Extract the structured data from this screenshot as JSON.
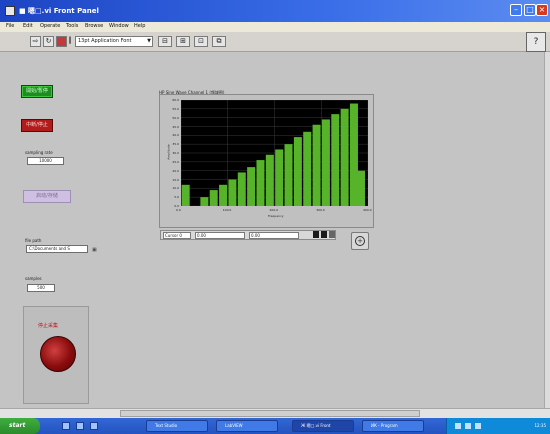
{
  "window": {
    "title": "■ 嗯□.vi Front Panel"
  },
  "menu": [
    "File",
    "Edit",
    "Operate",
    "Tools",
    "Browse",
    "Window",
    "Help"
  ],
  "toolbar": {
    "font_select": "13pt Application Font"
  },
  "panel": {
    "green_button": "開始/暫停",
    "red_button": "中断/停止",
    "sample_rate_label": "sampling rate",
    "sample_rate_value": "10000",
    "pink_button": "启动/存储",
    "file_path_label": "file path",
    "file_path_value": "C:\\Documents and S",
    "samples_label": "samples",
    "samples_value": "500",
    "stop_label": "停止采集"
  },
  "graph": {
    "title": "HP Sine Wave Channel 1 (频域图)",
    "y_label": "Amplitude",
    "x_label": "Frequency",
    "cursor": {
      "name": "Cursor 0",
      "x_value": "0.00",
      "y_value": "0.00"
    }
  },
  "chart_data": {
    "type": "bar",
    "title": "HP Sine Wave Channel 1 (频域图)",
    "xlabel": "Frequency",
    "ylabel": "Amplitude",
    "y_ticks": [
      "60.0",
      "55.0",
      "50.0",
      "45.0",
      "40.0",
      "35.0",
      "30.0",
      "25.0",
      "20.0",
      "15.0",
      "10.0",
      "5.0",
      "0.0"
    ],
    "x_ticks": [
      "0.0",
      "100.0",
      "200.0",
      "300.0",
      "400.0"
    ],
    "ylim": [
      0,
      60
    ],
    "xlim": [
      0,
      400
    ],
    "x": [
      10,
      30,
      50,
      70,
      90,
      110,
      130,
      150,
      170,
      190,
      210,
      230,
      250,
      270,
      290,
      310,
      330,
      350,
      370,
      385
    ],
    "values": [
      12,
      0,
      5,
      9,
      12,
      15,
      19,
      22,
      26,
      29,
      32,
      35,
      39,
      42,
      46,
      49,
      52,
      55,
      58,
      20
    ],
    "color": "#56b32a"
  },
  "taskbar": {
    "start_label": "start",
    "tasks": [
      "Text Studio",
      "LabVIEW",
      "Ж 嗯□.vi Front",
      "ИК - Program",
      "Ж 嗯□.vi Block"
    ],
    "clock": "12:35"
  }
}
